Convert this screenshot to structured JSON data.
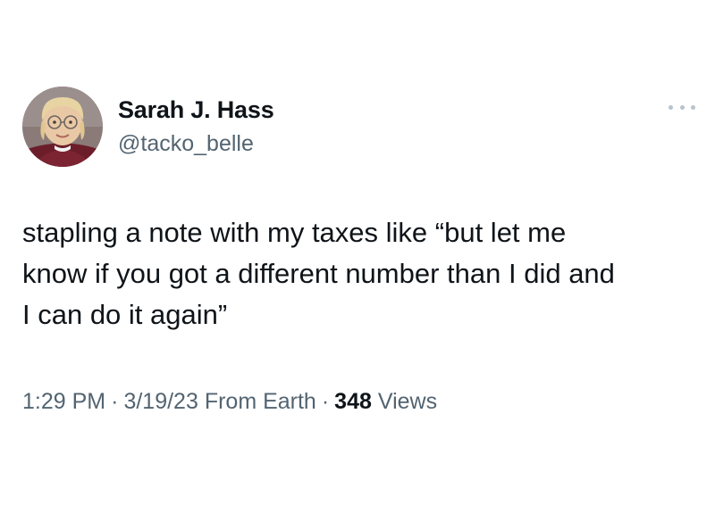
{
  "author": {
    "display_name": "Sarah J. Hass",
    "handle": "@tacko_belle",
    "avatar_icon": "child-with-glasses-avatar"
  },
  "menu": {
    "icon": "more-options-icon"
  },
  "tweet": {
    "text": "stapling a note with my taxes like “but let me\nknow if you got a different number than I did and\nI can do it again”"
  },
  "meta": {
    "time": "1:29 PM",
    "separator": "·",
    "date": "3/19/23",
    "source": "From Earth",
    "views_count": "348",
    "views_label": "Views"
  },
  "colors": {
    "text_primary": "#0f1419",
    "text_secondary": "#536471",
    "background": "#ffffff"
  }
}
